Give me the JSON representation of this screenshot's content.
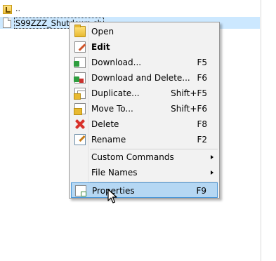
{
  "file_list": {
    "up_label": "..",
    "selected_file": "S99ZZZ_Shutdown.sh"
  },
  "context_menu": {
    "items": [
      {
        "label": "Open",
        "shortcut": "",
        "icon": "folder-open-icon"
      },
      {
        "label": "Edit",
        "shortcut": "",
        "icon": "edit-pencil-icon"
      },
      {
        "label": "Download...",
        "shortcut": "F5",
        "icon": "download-icon"
      },
      {
        "label": "Download and Delete...",
        "shortcut": "F6",
        "icon": "download-delete-icon"
      },
      {
        "label": "Duplicate...",
        "shortcut": "Shift+F5",
        "icon": "duplicate-icon"
      },
      {
        "label": "Move To...",
        "shortcut": "Shift+F6",
        "icon": "move-icon"
      },
      {
        "label": "Delete",
        "shortcut": "F8",
        "icon": "delete-x-icon"
      },
      {
        "label": "Rename",
        "shortcut": "F2",
        "icon": "rename-icon"
      },
      {
        "label": "Custom Commands",
        "shortcut": "",
        "icon": "",
        "submenu": true
      },
      {
        "label": "File Names",
        "shortcut": "",
        "icon": "",
        "submenu": true
      },
      {
        "label": "Properties",
        "shortcut": "F9",
        "icon": "properties-icon",
        "highlighted": true
      }
    ]
  },
  "colors": {
    "selection": "#cce8ff",
    "menu_background": "#f2f2f2",
    "menu_highlight": "#b5d7f3",
    "menu_highlight_border": "#4a97d8"
  }
}
